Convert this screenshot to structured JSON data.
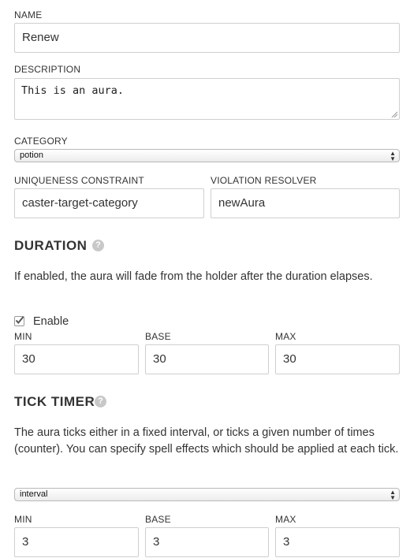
{
  "name": {
    "label": "NAME",
    "value": "Renew"
  },
  "description": {
    "label": "DESCRIPTION",
    "value": "This is an aura."
  },
  "category": {
    "label": "CATEGORY",
    "value": "potion"
  },
  "uniqueness": {
    "label": "UNIQUENESS CONSTRAINT",
    "value": "caster-target-category"
  },
  "violation": {
    "label": "VIOLATION RESOLVER",
    "value": "newAura"
  },
  "duration": {
    "heading": "DURATION",
    "help_icon": "question-circle-icon",
    "description": "If enabled, the aura will fade from the holder after the duration elapses.",
    "enable_label": "Enable",
    "enable_checked": true,
    "min_label": "MIN",
    "min_value": "30",
    "base_label": "BASE",
    "base_value": "30",
    "max_label": "MAX",
    "max_value": "30"
  },
  "tick_timer": {
    "heading": "TICK TIMER",
    "help_icon": "question-circle-icon",
    "description": "The aura ticks either in a fixed interval, or ticks a given number of times (counter). You can specify spell effects which should be applied at each tick.",
    "mode": "interval",
    "min_label": "MIN",
    "min_value": "3",
    "base_label": "BASE",
    "base_value": "3",
    "max_label": "MAX",
    "max_value": "3"
  }
}
